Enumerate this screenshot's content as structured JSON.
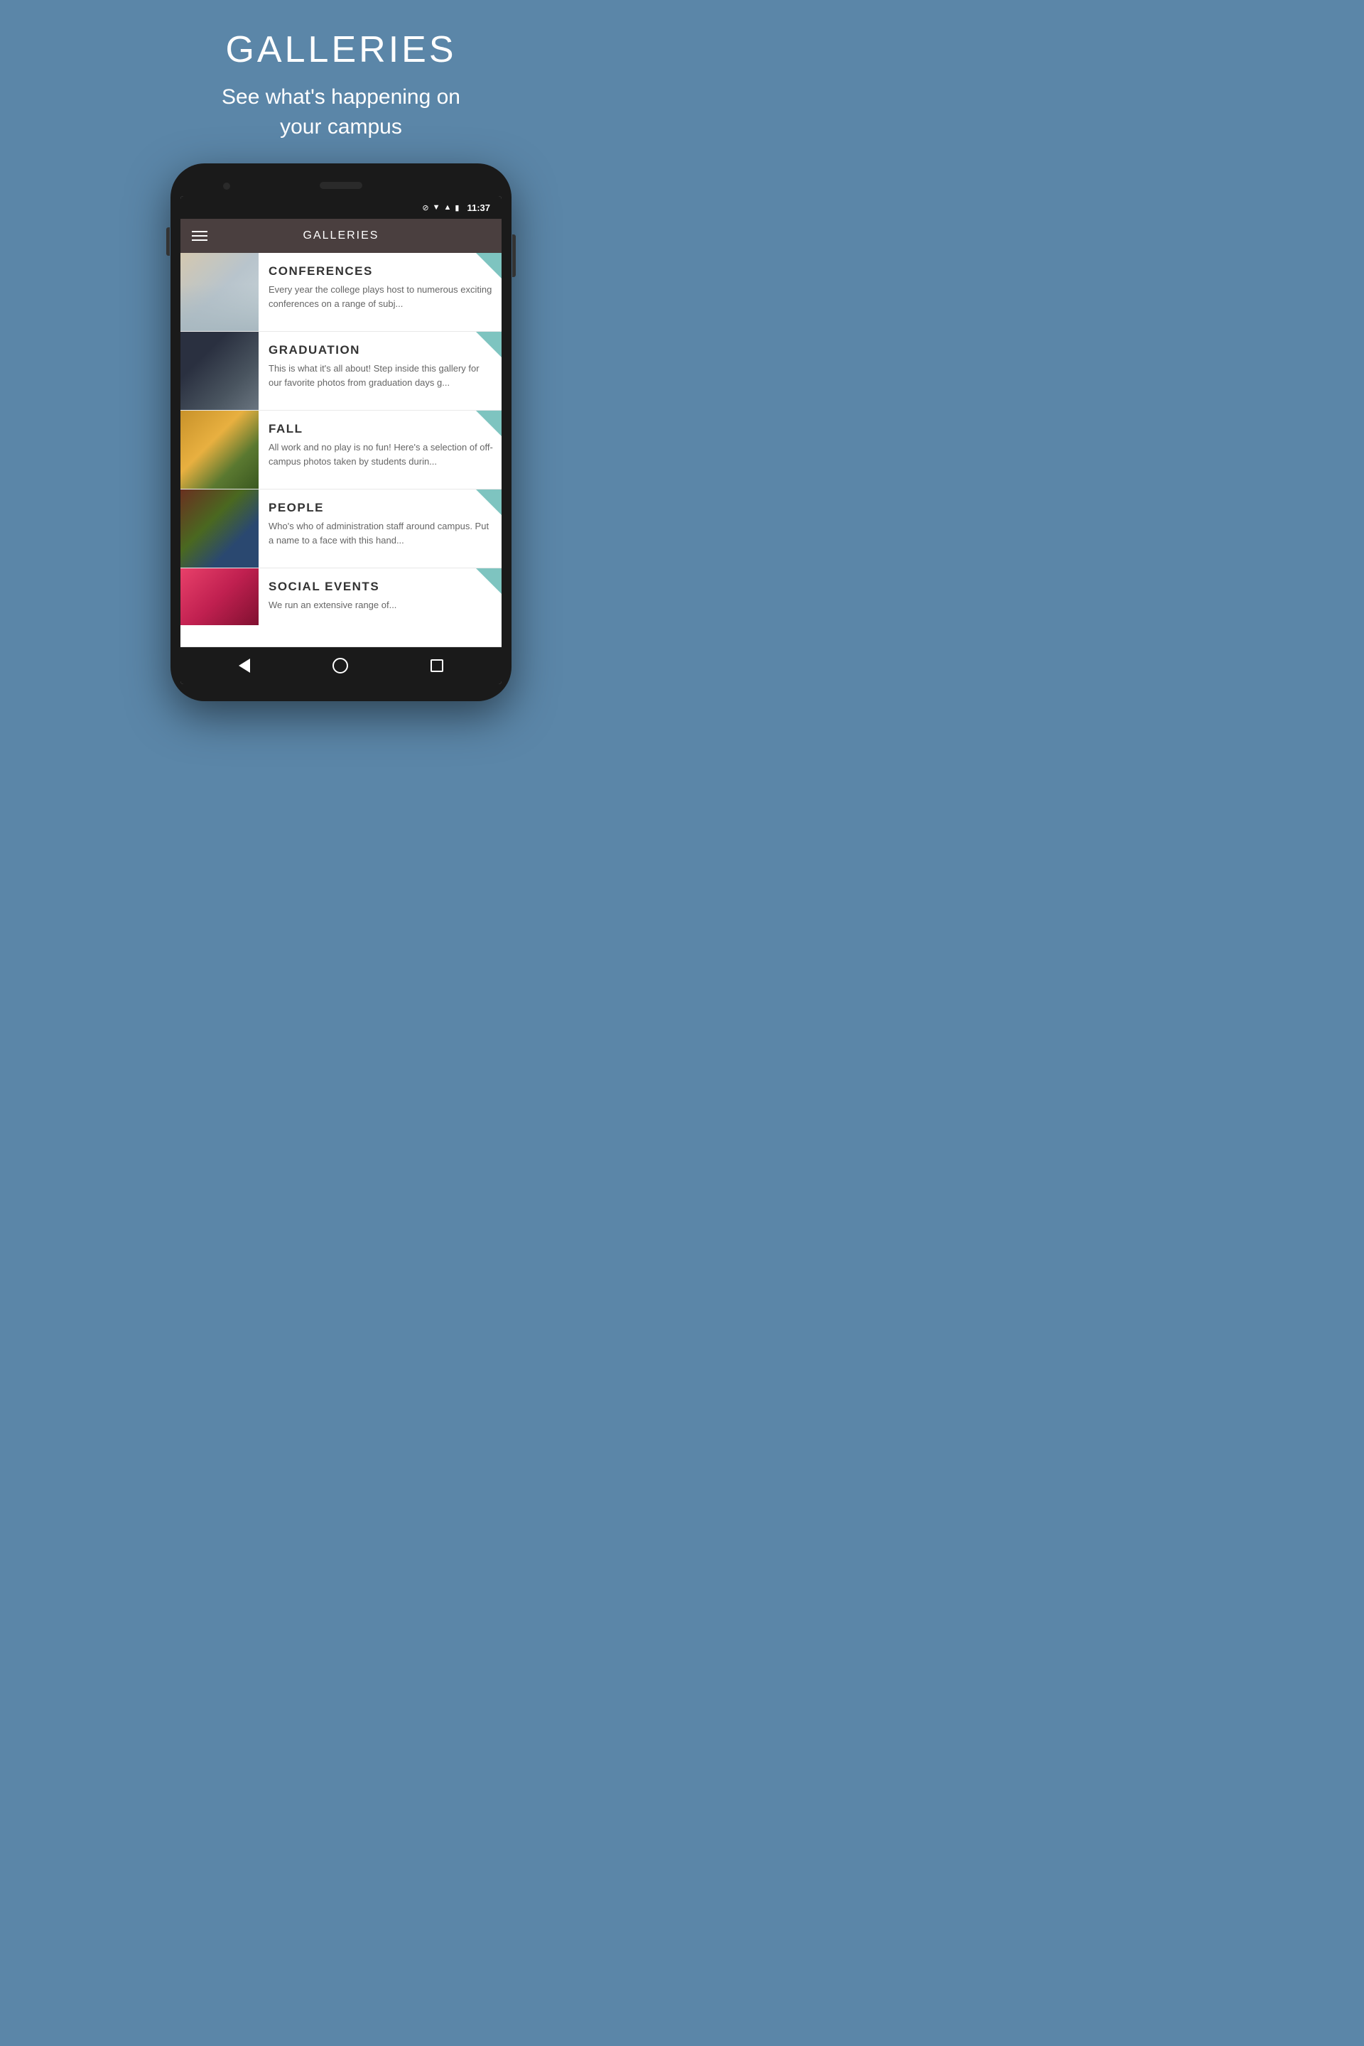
{
  "page": {
    "bg_color": "#5b86a8",
    "title": "GALLERIES",
    "subtitle": "See what's happening on\nyour campus"
  },
  "status_bar": {
    "time": "11:37"
  },
  "app_bar": {
    "title": "GALLERIES"
  },
  "gallery_items": [
    {
      "id": "conferences",
      "title": "CONFERENCES",
      "description": "Every year the college plays host to numerous exciting conferences on a range of subj..."
    },
    {
      "id": "graduation",
      "title": "GRADUATION",
      "description": "This is what it's all about!  Step inside this gallery for our favorite photos from graduation days g..."
    },
    {
      "id": "fall",
      "title": "FALL",
      "description": "All work and no play is no fun!  Here's a selection of off-campus photos taken by students durin..."
    },
    {
      "id": "people",
      "title": "PEOPLE",
      "description": "Who's who of administration staff around campus.  Put a name to a face with this hand..."
    },
    {
      "id": "social-events",
      "title": "SOCIAL EVENTS",
      "description": "We run an extensive range of..."
    }
  ],
  "bottom_nav": {
    "back_label": "back",
    "home_label": "home",
    "recent_label": "recent"
  }
}
